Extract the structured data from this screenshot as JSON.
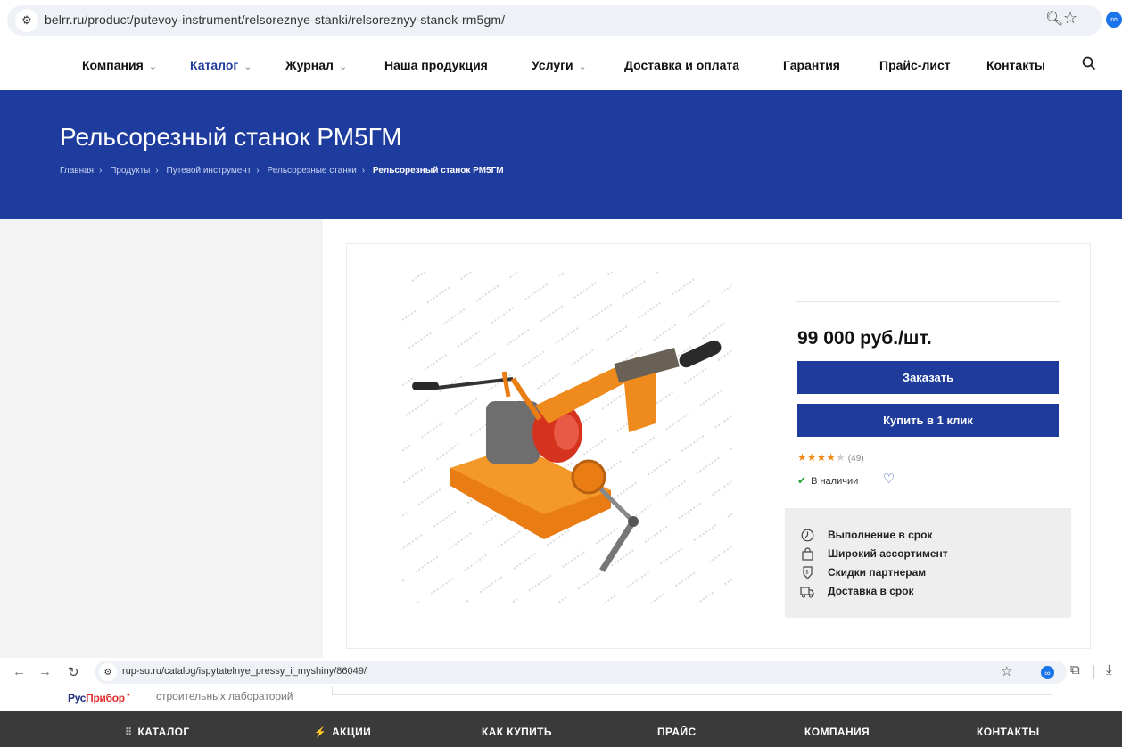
{
  "browser_top": {
    "url": "belrr.ru/product/putevoy-instrument/relsoreznye-stanki/relsoreznyy-stanok-rm5gm/"
  },
  "nav": {
    "items": [
      {
        "label": "Компания",
        "dropdown": true
      },
      {
        "label": "Каталог",
        "dropdown": true,
        "active": true
      },
      {
        "label": "Журнал",
        "dropdown": true
      },
      {
        "label": "Наша продукция",
        "dropdown": false
      },
      {
        "label": "Услуги",
        "dropdown": true
      },
      {
        "label": "Доставка и оплата",
        "dropdown": false
      },
      {
        "label": "Гарантия",
        "dropdown": false
      },
      {
        "label": "Прайс-лист",
        "dropdown": false
      },
      {
        "label": "Контакты",
        "dropdown": false
      }
    ]
  },
  "hero": {
    "title": "Рельсорезный станок РМ5ГМ",
    "breadcrumbs": [
      "Главная",
      "Продукты",
      "Путевой инструмент",
      "Рельсорезные станки",
      "Рельсорезный станок РМ5ГМ"
    ]
  },
  "product": {
    "price": "99 000 руб./шт.",
    "order_label": "Заказать",
    "one_click_label": "Купить в 1 клик",
    "rating": {
      "stars": 4,
      "max": 5,
      "count": "(49)"
    },
    "stock": "В наличии",
    "features": [
      {
        "icon": "clock-icon",
        "label": "Выполнение в срок"
      },
      {
        "icon": "shopping-bag-icon",
        "label": "Широкий ассортимент"
      },
      {
        "icon": "discount-tag-icon",
        "label": "Скидки партнерам"
      },
      {
        "icon": "delivery-truck-icon",
        "label": "Доставка в срок"
      }
    ]
  },
  "browser_bottom": {
    "url": "rup-su.ru/catalog/ispytatelnye_pressy_i_myshiny/86049/"
  },
  "site2": {
    "logo_part1": "Рус",
    "logo_part2": "Прибор",
    "tagline": "строительных лабораторий",
    "nav": [
      "КАТАЛОГ",
      "АКЦИИ",
      "КАК КУПИТЬ",
      "ПРАЙС",
      "КОМПАНИЯ",
      "КОНТАКТЫ"
    ]
  },
  "colors": {
    "brand_blue": "#1e3c9e",
    "button_blue": "#1f3c9c",
    "star_orange": "#f08a16",
    "stock_green": "#21a236",
    "dark_nav": "#3a3a3a"
  }
}
